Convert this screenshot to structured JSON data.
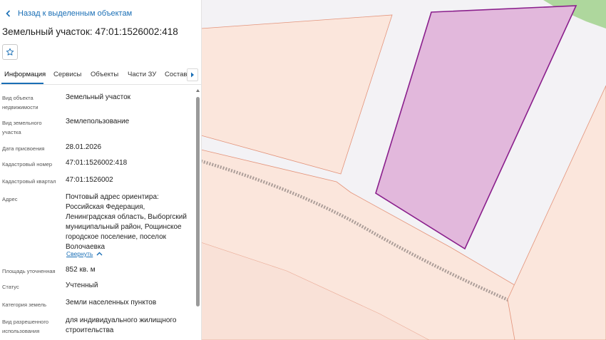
{
  "nav": {
    "back_label": "Назад к выделенным объектам"
  },
  "object": {
    "title": "Земельный участок: 47:01:1526002:418"
  },
  "tabs": [
    {
      "label": "Информация",
      "active": true
    },
    {
      "label": "Сервисы"
    },
    {
      "label": "Объекты"
    },
    {
      "label": "Части ЗУ"
    },
    {
      "label": "Состав"
    }
  ],
  "info": {
    "type_label": "Вид объекта недвижимости",
    "type_value": "Земельный участок",
    "land_kind_label": "Вид земельного участка",
    "land_kind_value": "Землепользование",
    "date_label": "Дата присвоения",
    "date_value": "28.01.2026",
    "cad_number_label": "Кадастровый номер",
    "cad_number_value": "47:01:1526002:418",
    "cad_quarter_label": "Кадастровый квартал",
    "cad_quarter_value": "47:01:1526002",
    "address_label": "Адрес",
    "address_value": "Почтовый адрес ориентира: Российская Федерация, Ленинградская область, Выборгский муниципальный район, Рощинское городское поселение, поселок Волочаевка",
    "collapse_label": "Свернуть",
    "area_label": "Площадь уточненная",
    "area_value": "852 кв. м",
    "status_label": "Статус",
    "status_value": "Учтенный",
    "category_label": "Категория земель",
    "category_value": "Земли населенных пунктов",
    "usage_label": "Вид разрешенного использования",
    "usage_value": "для индивидуального жилищного строительства"
  },
  "colors": {
    "accent": "#1a6fb6",
    "selected_parcel_fill": "#e2b8dc",
    "selected_parcel_stroke": "#8a1f8c",
    "parcel_fill": "#fbe6dc",
    "parcel_stroke": "#e3937a",
    "green_area": "#9ccf87"
  },
  "icons": [
    "chevron-left-icon",
    "star-icon",
    "chevron-right-icon",
    "chevron-up-icon"
  ]
}
